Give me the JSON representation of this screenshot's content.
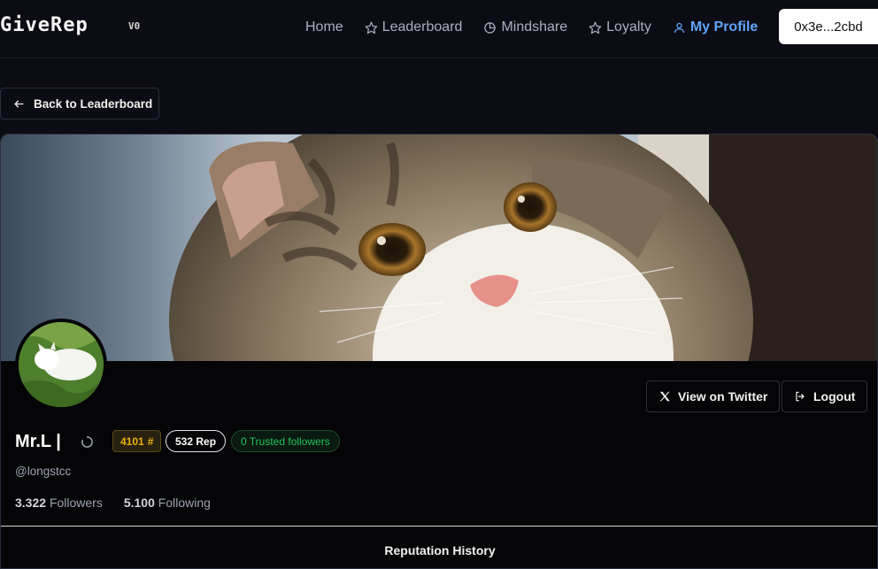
{
  "nav": {
    "logo": "GiveRep",
    "version": "V0",
    "links": [
      {
        "label": "Home",
        "icon": "none"
      },
      {
        "label": "Leaderboard",
        "icon": "star-icon"
      },
      {
        "label": "Mindshare",
        "icon": "pie-chart-icon"
      },
      {
        "label": "Loyalty",
        "icon": "star-icon"
      },
      {
        "label": "My Profile",
        "icon": "user-icon"
      }
    ],
    "wallet": "0x3e...2cbd"
  },
  "back_button": {
    "label": "Back to Leaderboard"
  },
  "profile": {
    "name": "Mr.L |",
    "rank": "4101",
    "rank_symbol": "#",
    "rep": "532 Rep",
    "trusted": "0 Trusted followers",
    "handle": "@longstcc",
    "followers_count": "3.322",
    "followers_label": "Followers",
    "following_count": "5.100",
    "following_label": "Following",
    "twitter_button": "View on Twitter",
    "logout_button": "Logout"
  },
  "section": {
    "title": "Reputation History"
  },
  "colors": {
    "accent": "#60a5fa",
    "rank": "#eab308",
    "trusted": "#22c55e"
  }
}
